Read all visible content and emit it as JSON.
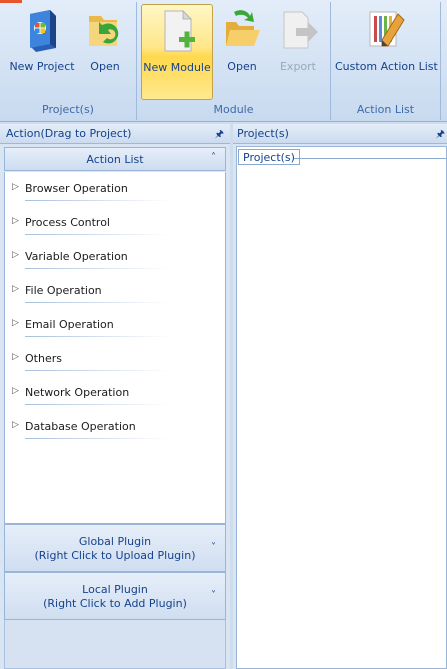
{
  "ribbon": {
    "groups": {
      "projects": "Project(s)",
      "module": "Module",
      "action_list": "Action List"
    },
    "buttons": {
      "new_project": "New Project",
      "open_project": "Open",
      "new_module": "New Module",
      "open_module": "Open",
      "export": "Export",
      "custom_action_list": "Custom Action List"
    }
  },
  "left_panel": {
    "title": "Action(Drag to Project)",
    "action_list_header": "Action List",
    "items": [
      "Browser Operation",
      "Process Control",
      "Variable Operation",
      "File Operation",
      "Email Operation",
      "Others",
      "Network Operation",
      "Database Operation"
    ],
    "global_plugin": {
      "title": "Global Plugin",
      "hint": "(Right Click to Upload Plugin)"
    },
    "local_plugin": {
      "title": "Local Plugin",
      "hint": "(Right Click to Add Plugin)"
    }
  },
  "right_panel": {
    "title": "Project(s)",
    "tab": "Project(s)"
  },
  "icons": {
    "new_project": "windows-box-icon",
    "open_project": "folder-green-arrow-icon",
    "new_module": "document-plus-icon",
    "open_module": "folder-open-icon",
    "export": "document-export-icon",
    "custom_action_list": "list-pen-icon",
    "pin": "pin-icon",
    "collapse": "chevron-up-double-icon",
    "expand": "chevron-down-double-icon",
    "tree": "tree-expand-triangle-icon"
  },
  "colors": {
    "ribbon_active": "#ffd84c",
    "accent": "#15428b"
  }
}
